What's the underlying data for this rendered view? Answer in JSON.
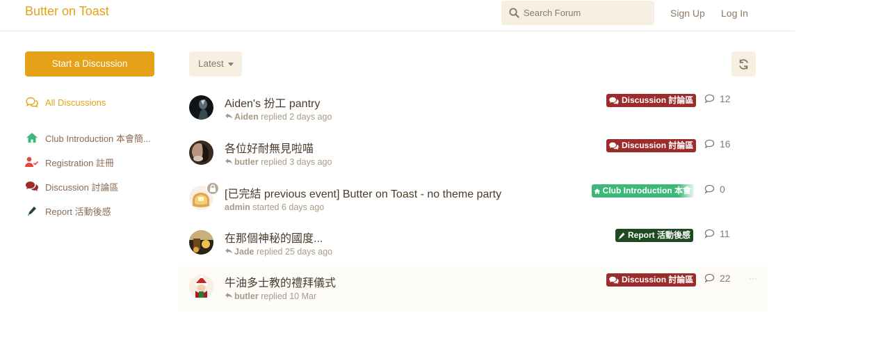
{
  "header": {
    "logo": "Butter on Toast",
    "search_placeholder": "Search Forum",
    "sign_up": "Sign Up",
    "log_in": "Log In"
  },
  "sidebar": {
    "start_button": "Start a Discussion",
    "items": [
      {
        "label": "All Discussions",
        "icon": "comments-icon",
        "color": "#e5a117"
      },
      {
        "label": "Club Introduction 本會簡...",
        "icon": "home-icon",
        "color": "#3cb878"
      },
      {
        "label": "Registration 註冊",
        "icon": "user-check-icon",
        "color": "#e2473f"
      },
      {
        "label": "Discussion 討論區",
        "icon": "comments-icon",
        "color": "#9c2c2c"
      },
      {
        "label": "Report 活動後感",
        "icon": "pen-icon",
        "color": "#1f4a1f"
      }
    ]
  },
  "toolbar": {
    "sort_label": "Latest",
    "refresh_icon": "refresh-icon"
  },
  "discussions": [
    {
      "title": "Aiden's 扮工 pantry",
      "user": "Aiden",
      "action": "replied",
      "time": "2 days ago",
      "tag": "Discussion 討論區",
      "tag_color": "#9c2c2c",
      "replies": "12"
    },
    {
      "title": "各位好耐無見啦喵",
      "user": "butler",
      "action": "replied",
      "time": "3 days ago",
      "tag": "Discussion 討論區",
      "tag_color": "#9c2c2c",
      "replies": "16"
    },
    {
      "title": "[已完結 previous event] Butter on Toast - no theme party",
      "user": "admin",
      "action": "started",
      "time": "6 days ago",
      "tag": "Club Introduction 本會",
      "tag_color": "#3cb878",
      "replies": "0",
      "locked": true
    },
    {
      "title": "在那個神秘的國度...",
      "user": "Jade",
      "action": "replied",
      "time": "25 days ago",
      "tag": "Report 活動後感",
      "tag_color": "#1f4a1f",
      "replies": "11"
    },
    {
      "title": "牛油多士教的禮拜儀式",
      "user": "butler",
      "action": "replied",
      "time": "10 Mar",
      "tag": "Discussion 討論區",
      "tag_color": "#9c2c2c",
      "replies": "22"
    }
  ]
}
